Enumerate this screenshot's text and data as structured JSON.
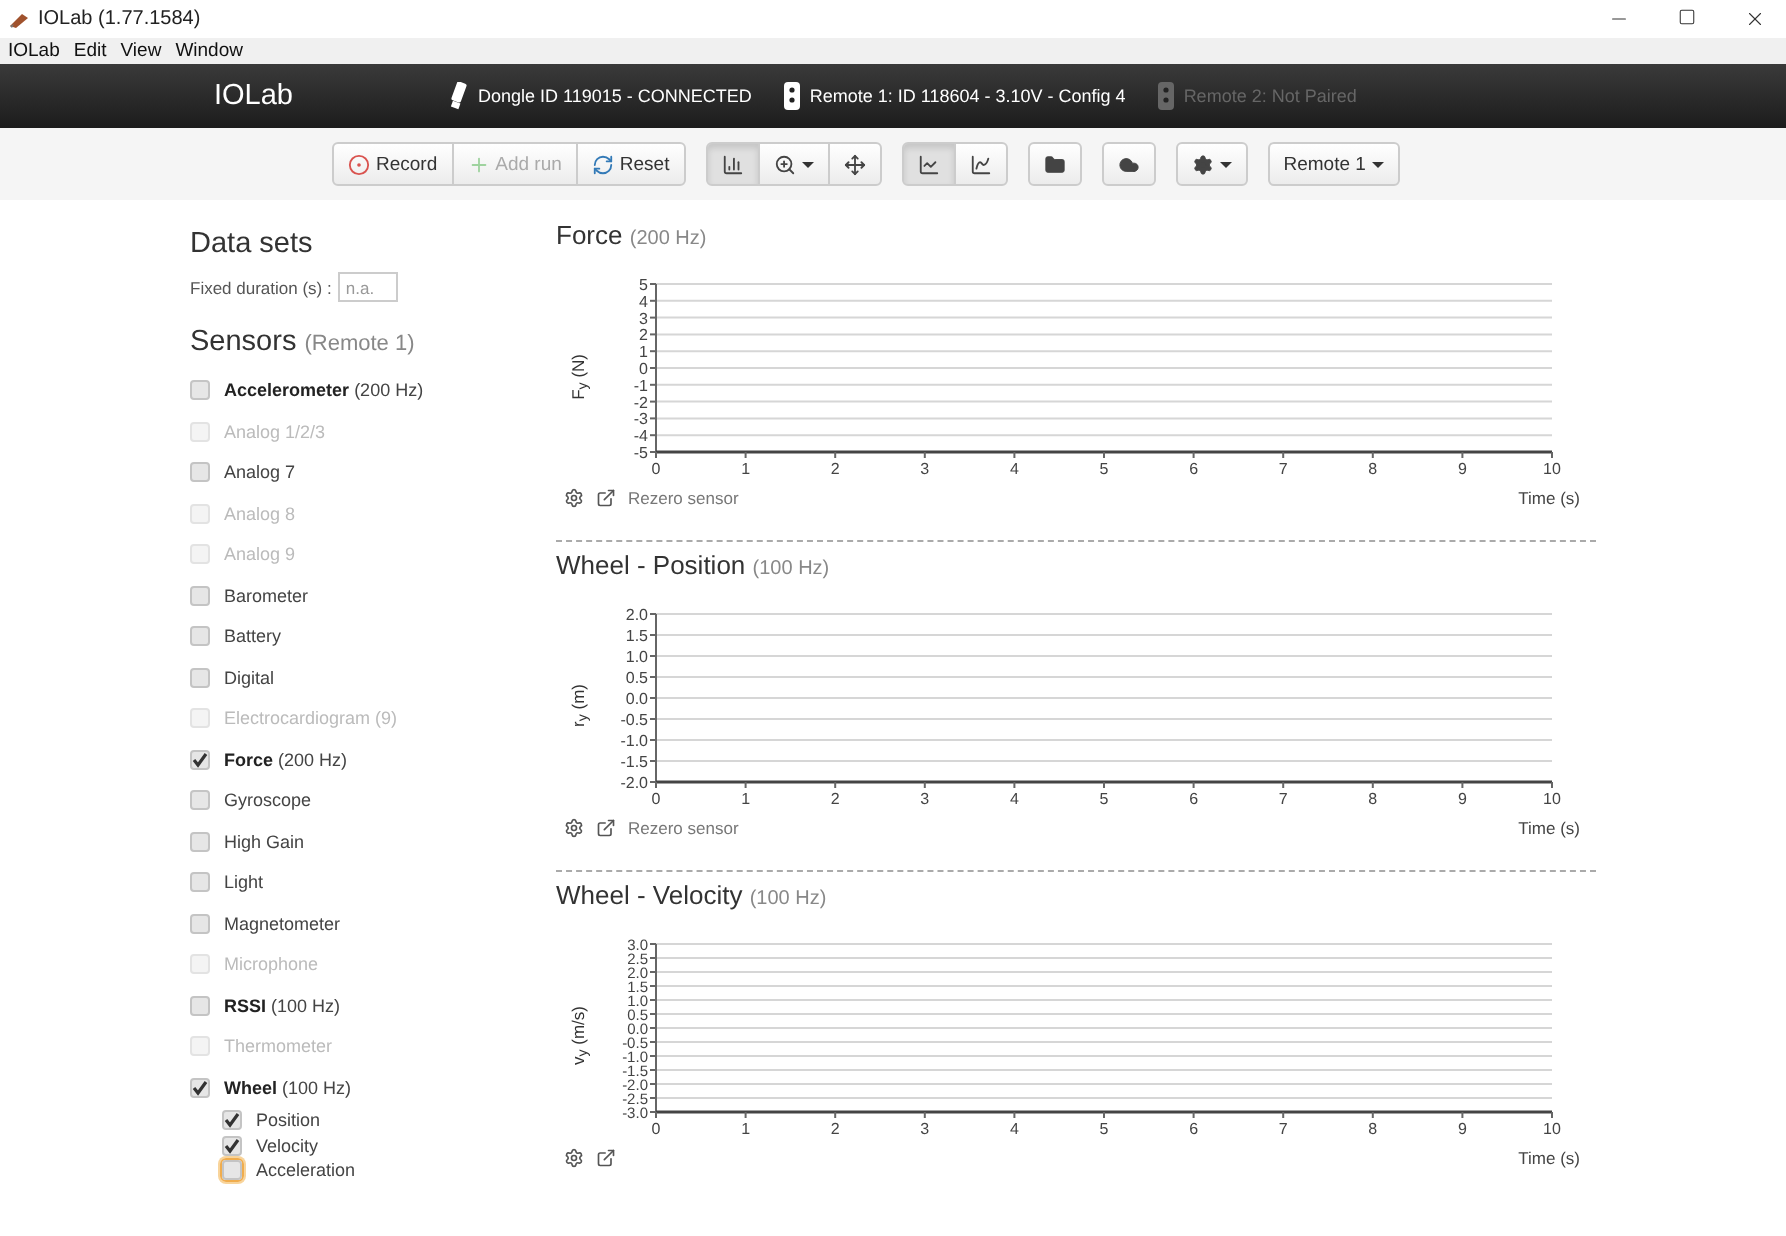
{
  "window": {
    "title": "IOLab (1.77.1584)"
  },
  "menu": [
    "IOLab",
    "Edit",
    "View",
    "Window"
  ],
  "header": {
    "brand": "IOLab",
    "devices": [
      {
        "label": "Dongle ID 119015 - CONNECTED",
        "kind": "dongle",
        "disabled": false
      },
      {
        "label": "Remote 1: ID 118604 - 3.10V - Config 4",
        "kind": "remote",
        "disabled": false
      },
      {
        "label": "Remote 2: Not Paired",
        "kind": "remote",
        "disabled": true
      }
    ]
  },
  "toolbar": {
    "groups": [
      {
        "buttons": [
          {
            "label": "Record",
            "disabled": false
          },
          {
            "label": "Add run",
            "disabled": true
          },
          {
            "label": "Reset",
            "disabled": false
          }
        ]
      },
      {
        "buttons": [
          {
            "selected": true,
            "caret": false
          },
          {
            "selected": false,
            "caret": true
          },
          {
            "selected": false,
            "caret": false
          }
        ]
      },
      {
        "buttons": [
          {
            "selected": true,
            "caret": false
          },
          {
            "selected": false,
            "caret": false
          }
        ]
      },
      {
        "buttons": [
          {
            "caret": false
          }
        ]
      },
      {
        "buttons": [
          {
            "caret": false
          }
        ]
      },
      {
        "buttons": [
          {
            "caret": true
          }
        ]
      },
      {
        "buttons": [
          {
            "label": "Remote 1",
            "caret": true
          }
        ]
      }
    ]
  },
  "sidebar": {
    "title": "Data sets",
    "fixed_duration": {
      "label": "Fixed duration (s) :",
      "placeholder": "n.a."
    },
    "sensors_title": "Sensors",
    "sensors_subtitle": "(Remote 1)",
    "sensors": [
      {
        "name": "Accelerometer",
        "rate": "(200 Hz)",
        "checked": false,
        "disabled": false
      },
      {
        "name": "Analog 1/2/3",
        "checked": false,
        "disabled": true
      },
      {
        "name": "Analog 7",
        "checked": false,
        "disabled": false
      },
      {
        "name": "Analog 8",
        "checked": false,
        "disabled": true
      },
      {
        "name": "Analog 9",
        "checked": false,
        "disabled": true
      },
      {
        "name": "Barometer",
        "checked": false,
        "disabled": false
      },
      {
        "name": "Battery",
        "checked": false,
        "disabled": false
      },
      {
        "name": "Digital",
        "checked": false,
        "disabled": false
      },
      {
        "name": "Electrocardiogram (9)",
        "checked": false,
        "disabled": true
      },
      {
        "name": "Force",
        "rate": "(200 Hz)",
        "checked": true,
        "disabled": false
      },
      {
        "name": "Gyroscope",
        "checked": false,
        "disabled": false
      },
      {
        "name": "High Gain",
        "checked": false,
        "disabled": false
      },
      {
        "name": "Light",
        "checked": false,
        "disabled": false
      },
      {
        "name": "Magnetometer",
        "checked": false,
        "disabled": false
      },
      {
        "name": "Microphone",
        "checked": false,
        "disabled": true
      },
      {
        "name": "RSSI",
        "rate": "(100 Hz)",
        "checked": false,
        "disabled": false
      },
      {
        "name": "Thermometer",
        "checked": false,
        "disabled": true
      },
      {
        "name": "Wheel",
        "rate": "(100 Hz)",
        "checked": true,
        "disabled": false,
        "children": [
          {
            "name": "Position",
            "checked": true,
            "focused": false
          },
          {
            "name": "Velocity",
            "checked": true,
            "focused": false
          },
          {
            "name": "Acceleration",
            "checked": false,
            "focused": true
          }
        ]
      }
    ]
  },
  "charts": [
    {
      "title": "Force",
      "rate": "(200 Hz)",
      "rezero": "Rezero sensor",
      "chart_data": {
        "type": "line",
        "grid": true,
        "xlabel": "Time (s)",
        "ylabel": "F$_{y}$ (N)",
        "xlim": [
          0,
          10
        ],
        "ylim": [
          -5,
          5
        ],
        "xticks": [
          0,
          1,
          2,
          3,
          4,
          5,
          6,
          7,
          8,
          9,
          10
        ],
        "yticks": [
          5,
          4,
          3,
          2,
          1,
          0,
          -1,
          -2,
          -3,
          -4,
          -5
        ]
      }
    },
    {
      "title": "Wheel - Position",
      "rate": "(100 Hz)",
      "rezero": "Rezero sensor",
      "chart_data": {
        "type": "line",
        "grid": true,
        "xlabel": "Time (s)",
        "ylabel": "r$_{y}$ (m)",
        "xlim": [
          0,
          10
        ],
        "ylim": [
          -2,
          2
        ],
        "xticks": [
          0,
          1,
          2,
          3,
          4,
          5,
          6,
          7,
          8,
          9,
          10
        ],
        "yticks": [
          {
            "value": 2,
            "label": "2.0"
          },
          {
            "value": 1.5,
            "label": "1.5"
          },
          {
            "value": 1,
            "label": "1.0"
          },
          {
            "value": 0.5,
            "label": "0.5"
          },
          {
            "value": 0,
            "label": "0.0"
          },
          {
            "value": -0.5,
            "label": "-0.5"
          },
          {
            "value": -1,
            "label": "-1.0"
          },
          {
            "value": -1.5,
            "label": "-1.5"
          },
          {
            "value": -2,
            "label": "-2.0"
          }
        ]
      }
    },
    {
      "title": "Wheel - Velocity",
      "rate": "(100 Hz)",
      "chart_data": {
        "type": "line",
        "grid": true,
        "xlabel": "Time (s)",
        "ylabel": "v$_{y}$ (m/s)",
        "xlim": [
          0,
          10
        ],
        "ylim": [
          -3,
          3
        ],
        "xticks": [
          0,
          1,
          2,
          3,
          4,
          5,
          6,
          7,
          8,
          9,
          10
        ],
        "yticks": [
          {
            "value": 3,
            "label": "3.0"
          },
          {
            "value": 2.5,
            "label": "2.5"
          },
          {
            "value": 2,
            "label": "2.0"
          },
          {
            "value": 1.5,
            "label": "1.5"
          },
          {
            "value": 1,
            "label": "1.0"
          },
          {
            "value": 0.5,
            "label": "0.5"
          },
          {
            "value": 0,
            "label": "0.0"
          },
          {
            "value": -0.5,
            "label": "-0.5"
          },
          {
            "value": -1,
            "label": "-1.0"
          },
          {
            "value": -1.5,
            "label": "-1.5"
          },
          {
            "value": -2,
            "label": "-2.0"
          },
          {
            "value": -2.5,
            "label": "-2.5"
          },
          {
            "value": -3,
            "label": "-3.0"
          }
        ]
      }
    }
  ]
}
